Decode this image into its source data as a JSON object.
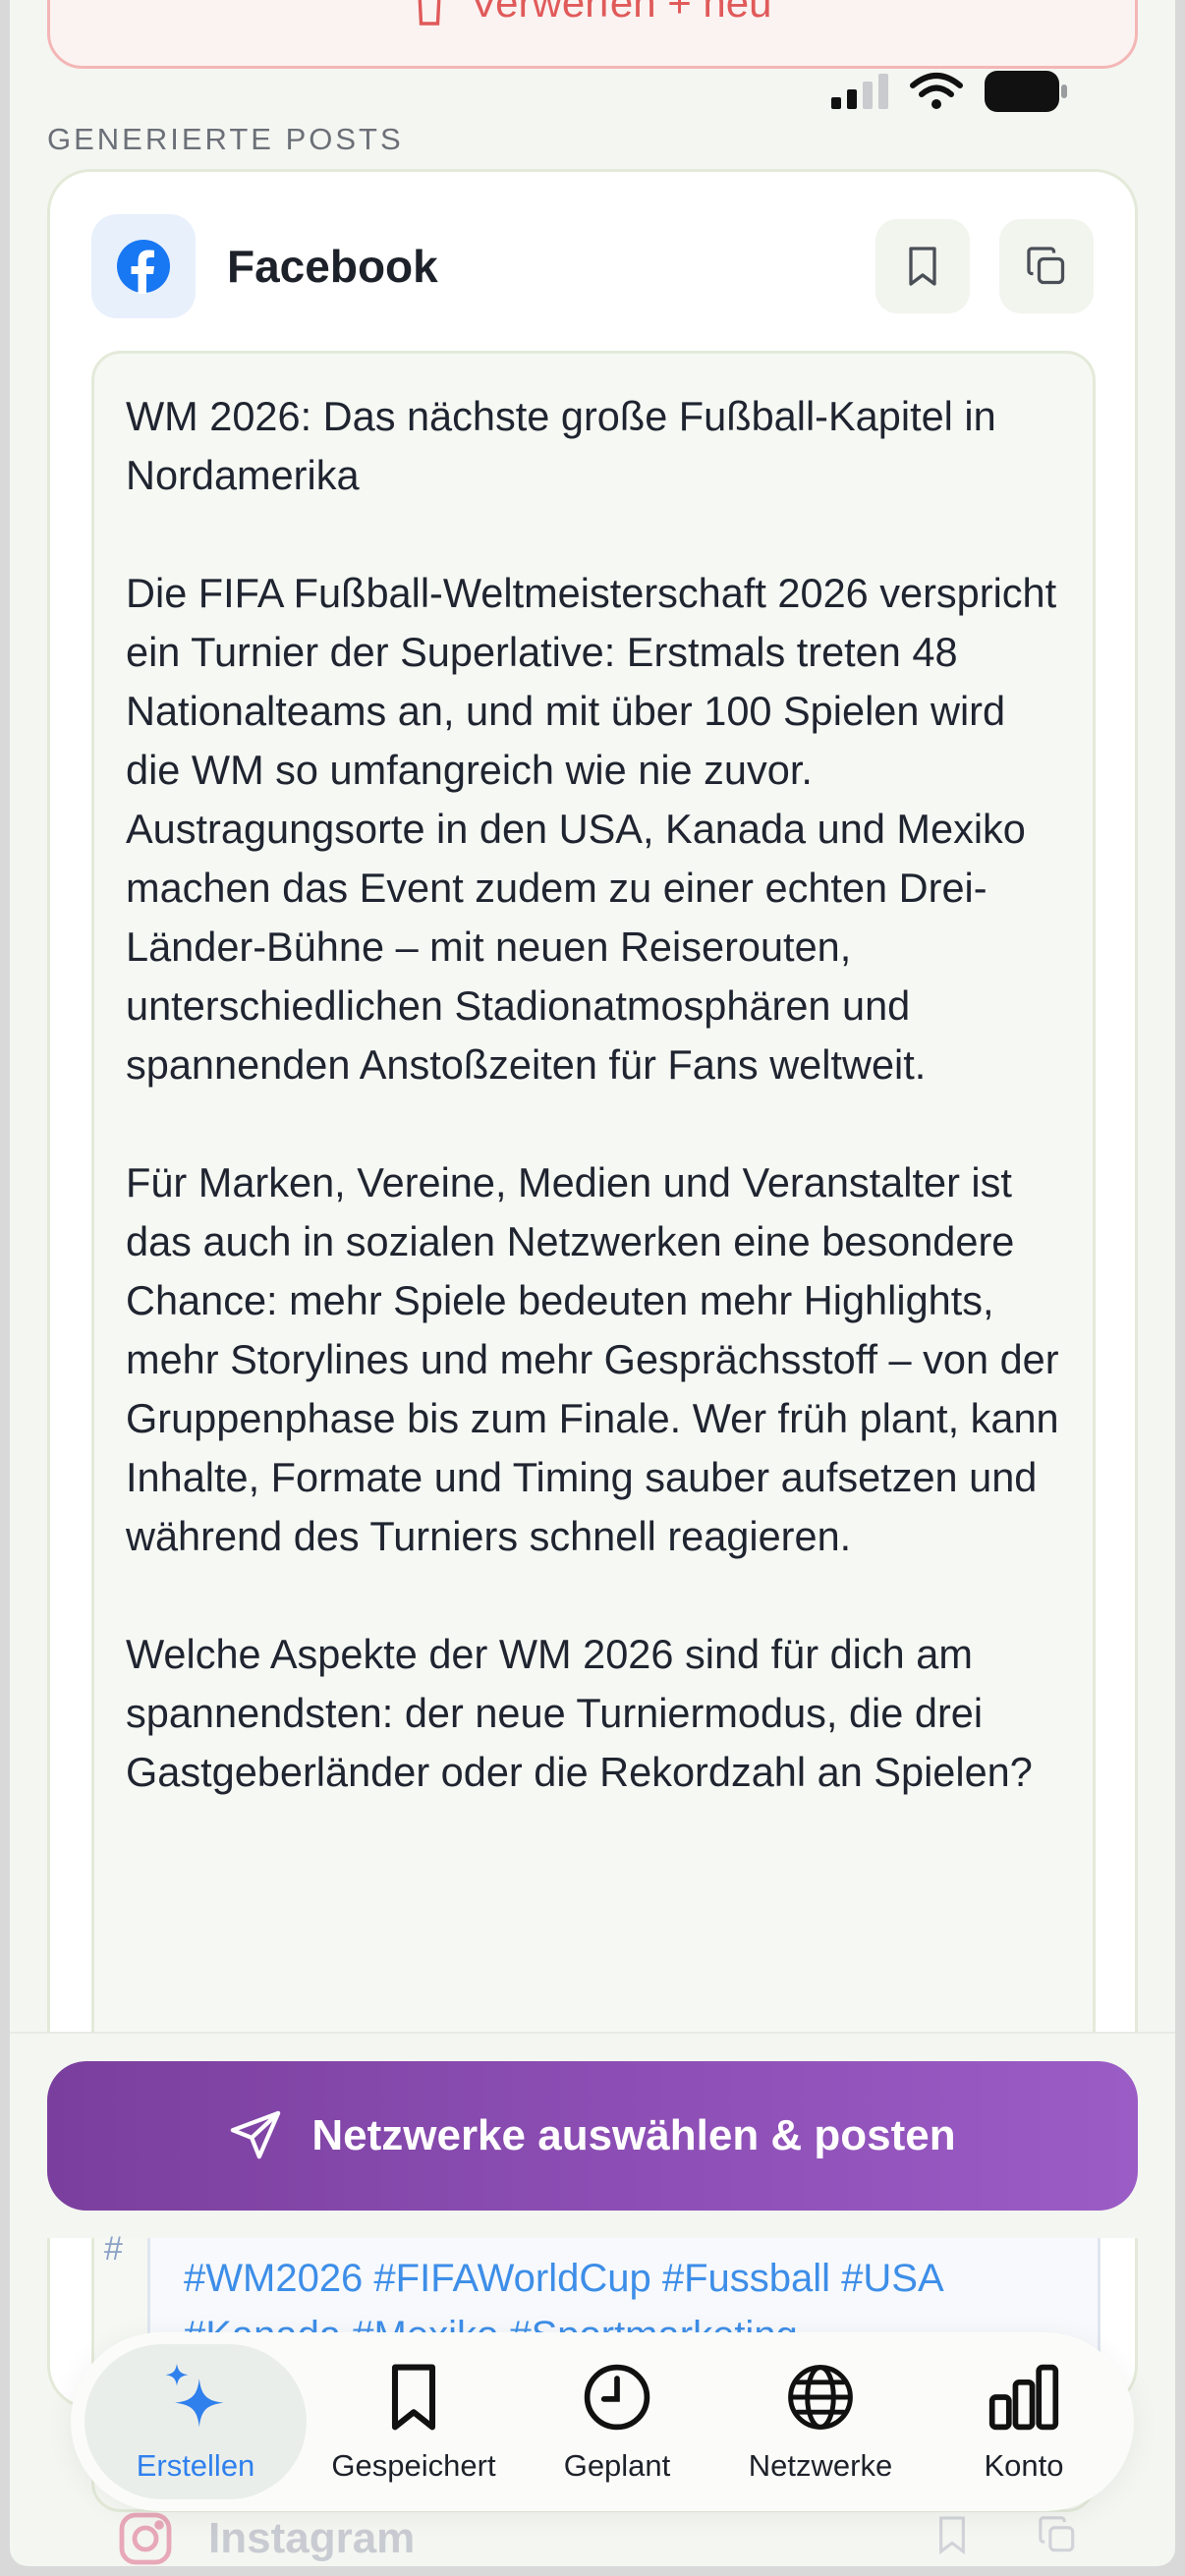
{
  "discard_button": {
    "label": "Verwerfen + neu",
    "icon": "trash-icon"
  },
  "section_label": "GENERIERTE POSTS",
  "post_card": {
    "platform": "Facebook",
    "platform_icon": "facebook-icon",
    "save_icon": "bookmark-icon",
    "copy_icon": "copy-icon",
    "text": "WM 2026: Das nächste große Fußball-Kapitel in Nordamerika\n\nDie FIFA Fußball-Weltmeisterschaft 2026 verspricht ein Turnier der Superlative: Erstmals treten 48 Nationalteams an, und mit über 100 Spielen wird die WM so umfangreich wie nie zuvor. Austragungsorte in den USA, Kanada und Mexiko machen das Event zudem zu einer echten Drei-Länder-Bühne – mit neuen Reiserouten, unterschiedlichen Stadionatmosphären und spannenden Anstoßzeiten für Fans weltweit.\n\nFür Marken, Vereine, Medien und Veranstalter ist das auch in sozialen Netzwerken eine besondere Chance: mehr Spiele bedeuten mehr Highlights, mehr Storylines und mehr Gesprächsstoff – von der Gruppenphase bis zum Finale. Wer früh plant, kann Inhalte, Formate und Timing sauber aufsetzen und während des Turniers schnell reagieren.\n\nWelche Aspekte der WM 2026 sind für dich am spannendsten: der neue Turniermodus, die drei Gastgeberländer oder die Rekordzahl an Spielen?",
    "hashtag_mark": "#",
    "hashtags_line1": "#WM2026 #FIFAWorldCup #Fussball #USA",
    "hashtags_line2": "#Kanada #Mexiko #Sportmarketing"
  },
  "cta_button": {
    "label": "Netzwerke auswählen & posten",
    "icon": "send-icon"
  },
  "nav": {
    "items": [
      {
        "label": "Erstellen",
        "icon": "sparkle-icon",
        "active": true
      },
      {
        "label": "Gespeichert",
        "icon": "bookmark-icon"
      },
      {
        "label": "Geplant",
        "icon": "clock-icon"
      },
      {
        "label": "Netzwerke",
        "icon": "globe-icon"
      },
      {
        "label": "Konto",
        "icon": "bar-chart-icon"
      }
    ]
  },
  "next_card": {
    "platform": "Instagram"
  },
  "colors": {
    "accent_blue": "#2f80ed",
    "cta_purple": "#8d4fb5",
    "danger": "#e05a5a"
  }
}
